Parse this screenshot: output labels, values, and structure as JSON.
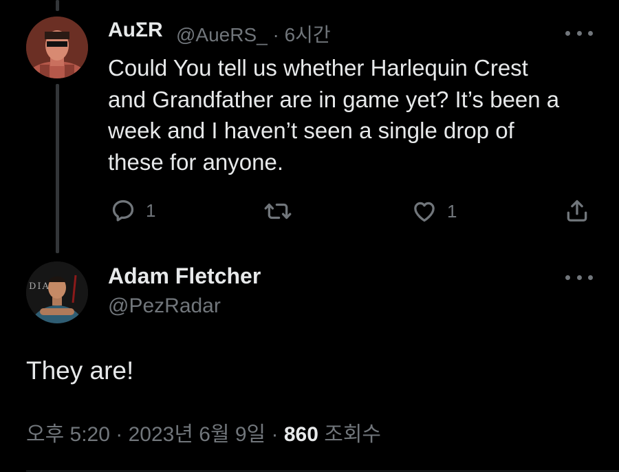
{
  "parent_tweet": {
    "author_name": "AuΣR",
    "meta": "@AueRS_ · 6시간",
    "text_lines": [
      "Could You tell us whether Harlequin Crest",
      "and Grandfather are in game yet? It’s been a",
      "week and I haven’t seen a single drop of",
      "these for anyone."
    ],
    "actions": {
      "reply_count": "1",
      "retweet_count": "",
      "like_count": "1"
    }
  },
  "reply_tweet": {
    "author_name": "Adam Fletcher",
    "handle": "@PezRadar",
    "avatar_text": "DIA",
    "text": "They are!",
    "timestamp": "오후 5:20 · 2023년 6월 9일 · ",
    "views_count": "860",
    "views_label": " 조회수"
  },
  "colors": {
    "background": "#000000",
    "primary_text": "#e7e9ea",
    "secondary_text": "#71767b",
    "thread_line": "#333639"
  }
}
